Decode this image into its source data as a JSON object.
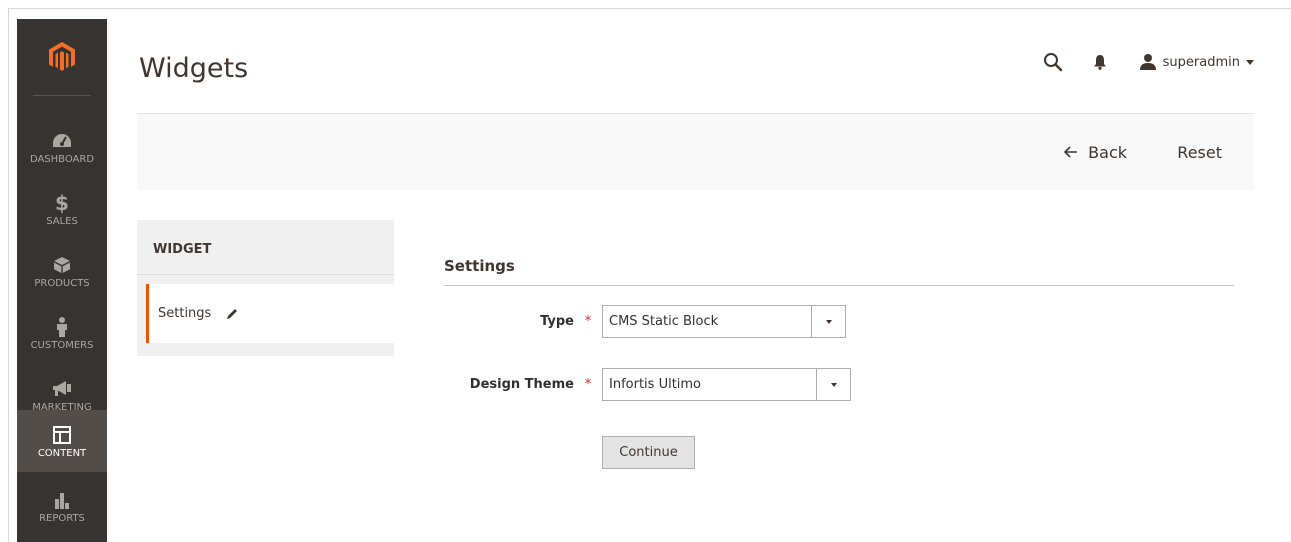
{
  "sidebar": {
    "logo": "magento-logo",
    "items": [
      {
        "label": "DASHBOARD",
        "icon": "dashboard-icon",
        "active": false
      },
      {
        "label": "SALES",
        "icon": "dollar-icon",
        "active": false
      },
      {
        "label": "PRODUCTS",
        "icon": "box-icon",
        "active": false
      },
      {
        "label": "CUSTOMERS",
        "icon": "person-icon",
        "active": false
      },
      {
        "label": "MARKETING",
        "icon": "megaphone-icon",
        "active": false
      },
      {
        "label": "CONTENT",
        "icon": "layout-icon",
        "active": true
      },
      {
        "label": "REPORTS",
        "icon": "bar-chart-icon",
        "active": false
      }
    ]
  },
  "header": {
    "title": "Widgets",
    "user": "superadmin"
  },
  "action_bar": {
    "back_label": "Back",
    "reset_label": "Reset"
  },
  "tabs": {
    "heading": "WIDGET",
    "items": [
      {
        "label": "Settings",
        "active": true
      }
    ]
  },
  "form": {
    "fieldset_title": "Settings",
    "fields": [
      {
        "label": "Type",
        "value": "CMS Static Block",
        "required": true
      },
      {
        "label": "Design Theme",
        "value": "Infortis Ultimo",
        "required": true
      }
    ],
    "continue_label": "Continue"
  },
  "colors": {
    "sidebar_bg": "#373330",
    "sidebar_active_bg": "#524d49",
    "accent": "#eb5202",
    "required": "#e22626"
  }
}
